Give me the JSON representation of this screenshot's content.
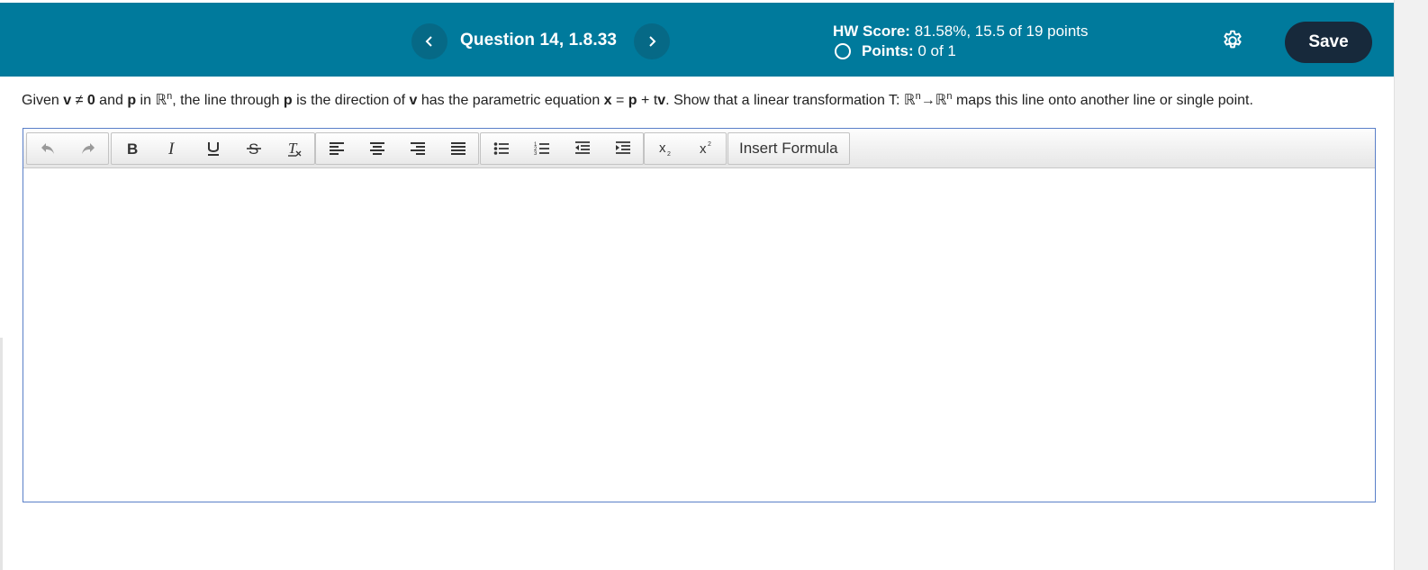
{
  "header": {
    "question_title": "Question 14, 1.8.33",
    "hw_score_label": "HW Score:",
    "hw_score_value": "81.58%, 15.5 of 19 points",
    "points_label": "Points:",
    "points_value": "0 of 1",
    "save_label": "Save",
    "background_color": "#007a9c",
    "save_color": "#17293b"
  },
  "prompt": {
    "t1": "Given ",
    "v": "v",
    "ne": " ≠ ",
    "zero": "0",
    "t2": " and ",
    "p": "p",
    "t3": " in ℝ",
    "n1": "n",
    "t4": ", the line through ",
    "p2": "p",
    "t5": " is the direction of ",
    "v2": "v",
    "t6": " has the parametric equation ",
    "x": "x",
    "eq": " = ",
    "p3": "p",
    "plus": " + t",
    "v3": "v",
    "t7": ". Show that a linear transformation T: ℝ",
    "n2": "n",
    "arrow": "→ℝ",
    "n3": "n",
    "t8": " maps this line onto another line or single point."
  },
  "toolbar": {
    "icons": [
      "undo-icon",
      "redo-icon",
      "bold-icon",
      "italic-icon",
      "underline-icon",
      "strikethrough-icon",
      "clear-format-icon",
      "align-left-icon",
      "align-center-icon",
      "align-right-icon",
      "justify-icon",
      "bullet-list-icon",
      "numbered-list-icon",
      "outdent-icon",
      "indent-icon",
      "subscript-icon",
      "superscript-icon"
    ],
    "insert_formula_label": "Insert Formula"
  },
  "editor": {
    "border_color": "#5a7fc8"
  }
}
